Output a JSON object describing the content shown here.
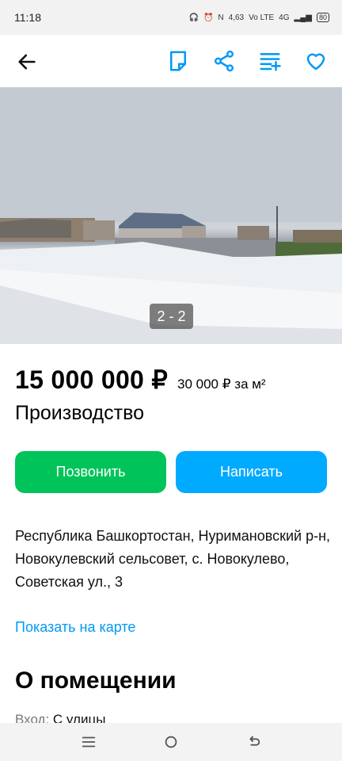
{
  "status": {
    "time": "11:18",
    "net_speed": "4,63",
    "net_unit": "K/S",
    "volte": "Vo LTE",
    "network": "4G",
    "battery": "80"
  },
  "header": {
    "back_icon": "arrow-left-icon",
    "actions": [
      "note-icon",
      "share-icon",
      "compare-icon",
      "heart-icon"
    ]
  },
  "photo": {
    "counter": "2 - 2"
  },
  "listing": {
    "price": "15 000 000 ₽",
    "price_per_m2": "30 000 ₽ за м²",
    "title": "Производство",
    "call_label": "Позвонить",
    "write_label": "Написать",
    "address": "Республика Башкортостан, Нуримановский р-н, Новокулевский сельсовет, с. Новокулево, Советская ул., 3",
    "map_link": "Показать на карте"
  },
  "about": {
    "heading": "О помещении",
    "entrance_label": "Вход:",
    "entrance_value": "С улицы"
  },
  "colors": {
    "call": "#00c35a",
    "write": "#00aaff",
    "link": "#0099f7"
  }
}
